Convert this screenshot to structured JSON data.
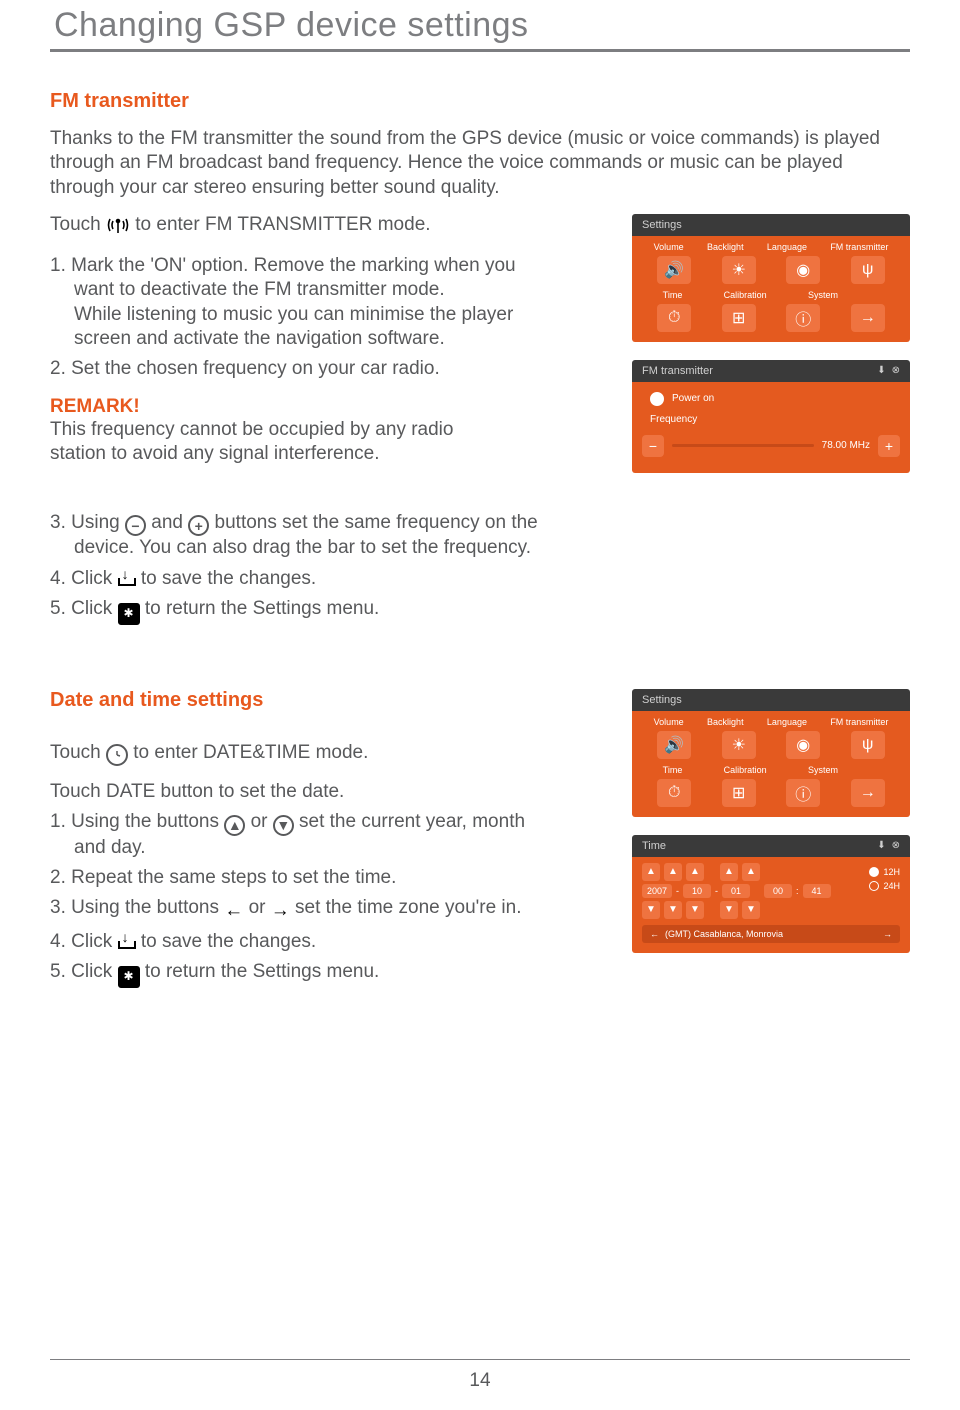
{
  "page": {
    "title": "Changing GSP device settings",
    "number": "14"
  },
  "fm": {
    "heading": "FM transmitter",
    "intro": "Thanks to the FM transmitter the sound from the GPS device (music or voice commands) is played through an FM broadcast  band frequency. Hence the voice commands or music can be played through your car stereo ensuring better sound quality.",
    "touch_pre": "Touch",
    "touch_post": " to enter  FM TRANSMITTER mode.",
    "step1_a": "1. Mark the 'ON' option. Remove the marking when you",
    "step1_b": "want to deactivate the FM transmitter mode.",
    "step1_c": "While listening to music you can minimise the player",
    "step1_d": "screen and activate the navigation software.",
    "step2": "2. Set the chosen frequency on your car radio.",
    "remark_heading": "REMARK!",
    "remark_body_a": "This frequency cannot be occupied by any radio",
    "remark_body_b": "station to avoid any signal interference.",
    "step3_a": "3. Using ",
    "step3_b": " and ",
    "step3_c": " buttons set the same frequency on the",
    "step3_d": "device. You can also drag the bar to set the frequency.",
    "step4_a": "4. Click ",
    "step4_b": "  to save the changes.",
    "step5_a": "5. Click ",
    "step5_b": "  to return the Settings menu."
  },
  "dt": {
    "heading": "Date and time settings",
    "touch_pre": "Touch ",
    "touch_post": " to enter DATE&TIME mode.",
    "line_date": "Touch DATE button to set the date.",
    "step1_a": "1. Using the buttons ",
    "step1_b": " or ",
    "step1_c": " set the current year, month",
    "step1_d": "and day.",
    "step2": "2. Repeat the same steps to set the time.",
    "step3_a": "3. Using the buttons ",
    "step3_b": " or ",
    "step3_c": "  set the time zone you're in.",
    "step4_a": "4. Click ",
    "step4_b": "  to save the changes.",
    "step5_a": "5. Click ",
    "step5_b": "  to return the Settings menu."
  },
  "mock": {
    "settings_title": "Settings",
    "row1": [
      "Volume",
      "Backlight",
      "Language",
      "FM transmitter"
    ],
    "row2": [
      "Time",
      "Calibration",
      "System",
      ""
    ],
    "fm_title": "FM transmitter",
    "fm_power": "Power on",
    "fm_freq_label": "Frequency",
    "fm_freq_value": "78.00 MHz",
    "time_title": "Time",
    "date_vals": [
      "2007",
      "10",
      "01"
    ],
    "time_vals": [
      "00",
      "41"
    ],
    "h12": "12H",
    "h24": "24H",
    "tz": "(GMT) Casablanca, Monrovia"
  }
}
